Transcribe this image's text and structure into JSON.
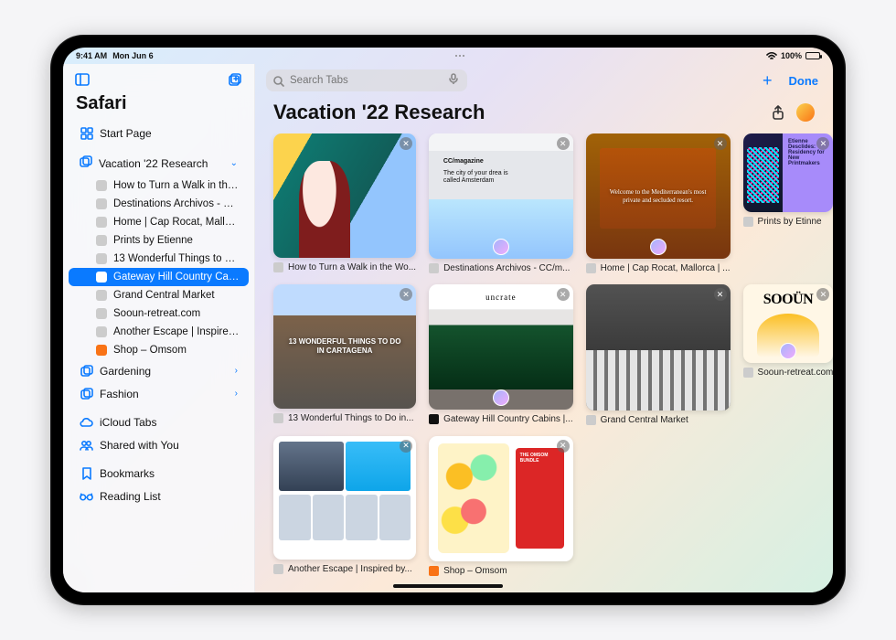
{
  "status": {
    "time": "9:41 AM",
    "date": "Mon Jun 6",
    "battery": "100%"
  },
  "app_title": "Safari",
  "sidebar": {
    "start_page": "Start Page",
    "groups": [
      {
        "name": "Vacation '22 Research",
        "expanded": true,
        "tabs": [
          "How to Turn a Walk in the ...",
          "Destinations Archivos - CC...",
          "Home | Cap Rocat, Mallorc...",
          "Prints by Etienne",
          "13 Wonderful Things to Do...",
          "Gateway Hill Country Cabi...",
          "Grand Central Market",
          "Sooun-retreat.com",
          "Another Escape | Inspired...",
          "Shop – Omsom"
        ],
        "selected_index": 5
      },
      {
        "name": "Gardening",
        "expanded": false
      },
      {
        "name": "Fashion",
        "expanded": false
      }
    ],
    "icloud_tabs": "iCloud Tabs",
    "shared": "Shared with You",
    "bookmarks": "Bookmarks",
    "reading_list": "Reading List"
  },
  "toolbar": {
    "search_placeholder": "Search Tabs",
    "done": "Done"
  },
  "main": {
    "title": "Vacation '22 Research",
    "tabs": [
      {
        "title": "How to Turn a Walk in the Wo...",
        "shared": false
      },
      {
        "title": "Destinations Archivos - CC/m...",
        "shared": true
      },
      {
        "title": "Home | Cap Rocat, Mallorca | ...",
        "shared": true
      },
      {
        "title": "Prints by Etinne",
        "shared": false
      },
      {
        "title": "13 Wonderful Things to Do in...",
        "shared": false
      },
      {
        "title": "Gateway Hill Country Cabins |...",
        "shared": true
      },
      {
        "title": "Grand Central Market",
        "shared": false
      },
      {
        "title": "Sooun-retreat.com",
        "shared": true
      },
      {
        "title": "Another Escape | Inspired by...",
        "shared": false
      },
      {
        "title": "Shop – Omsom",
        "shared": false
      }
    ]
  },
  "thumb_text": {
    "cc_title": "CC/magazine",
    "cc_tag": "The city of your drea is called Amsterdam",
    "caprocat": "Welcome to the Mediterranean's most private and secluded resort.",
    "etienne": "Etienne Desclides: Residency for New Printmakers",
    "cartagena": "13 WONDERFUL THINGS TO DO IN CARTAGENA",
    "uncrate": "uncrate",
    "sooun": "SOOÜN",
    "omsom": "THE OMSOM BUNDLE"
  }
}
